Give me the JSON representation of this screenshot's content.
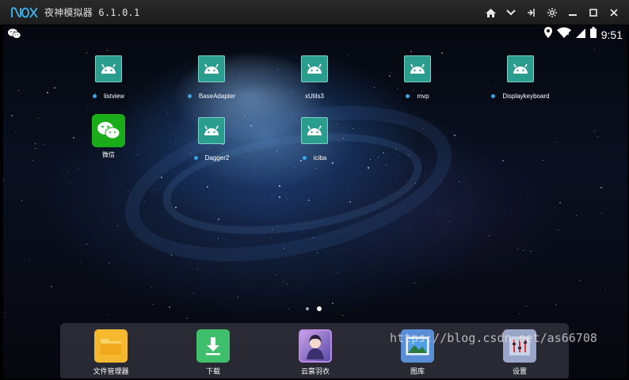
{
  "window": {
    "logo_text": "nox",
    "title": "夜神模拟器 6.1.0.1",
    "controls": [
      "home-icon",
      "chevron-down-icon",
      "pin-icon",
      "settings-icon",
      "minimize-icon",
      "maximize-icon",
      "close-icon"
    ]
  },
  "statusbar": {
    "notification_icon": "wechat-icon",
    "indicators": [
      "location-icon",
      "wifi-icon",
      "signal-icon",
      "battery-icon"
    ],
    "time": "9:51"
  },
  "desktop": {
    "apps": [
      {
        "label": "listview",
        "icon": "android-icon"
      },
      {
        "label": "BaseAdapter",
        "icon": "android-icon"
      },
      {
        "label": "xUtils3",
        "icon": "android-icon"
      },
      {
        "label": "mvp",
        "icon": "android-icon"
      },
      {
        "label": "Displaykeyboard",
        "icon": "android-icon"
      },
      {
        "label": "微信",
        "icon": "wechat-icon"
      },
      {
        "label": "Dagger2",
        "icon": "android-icon"
      },
      {
        "label": "iciba",
        "icon": "android-icon"
      }
    ],
    "page_count": 2,
    "current_page": 2
  },
  "dock": {
    "items": [
      {
        "label": "文件管理器",
        "icon": "folder-icon",
        "color": "#f5b82e"
      },
      {
        "label": "下载",
        "icon": "download-icon",
        "color": "#3fbf6b"
      },
      {
        "label": "云裳羽衣",
        "icon": "game-icon",
        "color": "#7a5fb0"
      },
      {
        "label": "图库",
        "icon": "gallery-icon",
        "color": "#5a8fd8"
      },
      {
        "label": "设置",
        "icon": "settings-icon",
        "color": "#9aa6c8"
      }
    ]
  },
  "watermark": "https://blog.csdn.net/as66708"
}
